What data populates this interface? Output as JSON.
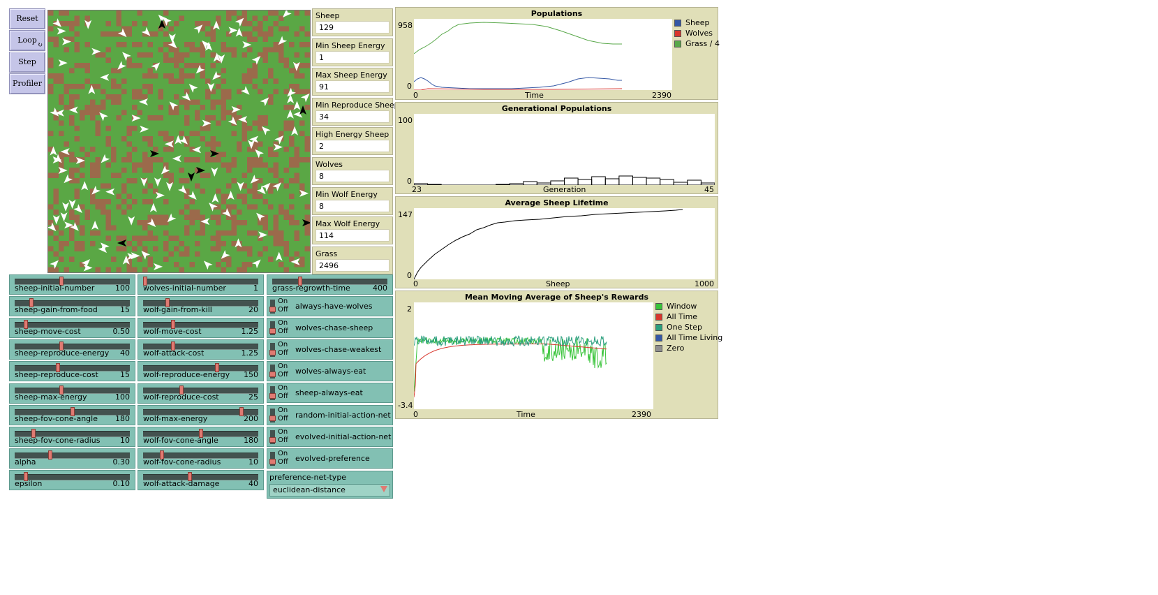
{
  "buttons": {
    "reset": "Reset",
    "loop": "Loop",
    "step": "Step",
    "profiler": "Profiler"
  },
  "monitors": [
    {
      "label": "Sheep",
      "value": "129"
    },
    {
      "label": "Min Sheep Energy",
      "value": "1"
    },
    {
      "label": "Max Sheep Energy",
      "value": "91"
    },
    {
      "label": "Min Reproduce Sheep",
      "value": "34"
    },
    {
      "label": "High Energy Sheep",
      "value": "2"
    },
    {
      "label": "Wolves",
      "value": "8"
    },
    {
      "label": "Min Wolf Energy",
      "value": "8"
    },
    {
      "label": "Max Wolf Energy",
      "value": "114"
    },
    {
      "label": "Grass",
      "value": "2496"
    }
  ],
  "sliders_col1": [
    {
      "name": "sheep-initial-number",
      "value": "100",
      "level": 0.4
    },
    {
      "name": "sheep-gain-from-food",
      "value": "15",
      "level": 0.13
    },
    {
      "name": "sheep-move-cost",
      "value": "0.50",
      "level": 0.08
    },
    {
      "name": "sheep-reproduce-energy",
      "value": "40",
      "level": 0.4
    },
    {
      "name": "sheep-reproduce-cost",
      "value": "15",
      "level": 0.37
    },
    {
      "name": "sheep-max-energy",
      "value": "100",
      "level": 0.4
    },
    {
      "name": "sheep-fov-cone-angle",
      "value": "180",
      "level": 0.5
    },
    {
      "name": "sheep-fov-cone-radius",
      "value": "10",
      "level": 0.15
    },
    {
      "name": "alpha",
      "value": "0.30",
      "level": 0.3
    },
    {
      "name": "epsilon",
      "value": "0.10",
      "level": 0.08
    }
  ],
  "sliders_col2": [
    {
      "name": "wolves-initial-number",
      "value": "1",
      "level": 0.0
    },
    {
      "name": "wolf-gain-from-kill",
      "value": "20",
      "level": 0.2
    },
    {
      "name": "wolf-move-cost",
      "value": "1.25",
      "level": 0.25
    },
    {
      "name": "wolf-attack-cost",
      "value": "1.25",
      "level": 0.25
    },
    {
      "name": "wolf-reproduce-energy",
      "value": "150",
      "level": 0.65
    },
    {
      "name": "wolf-reproduce-cost",
      "value": "25",
      "level": 0.33
    },
    {
      "name": "wolf-max-energy",
      "value": "200",
      "level": 0.87
    },
    {
      "name": "wolf-fov-cone-angle",
      "value": "180",
      "level": 0.5
    },
    {
      "name": "wolf-fov-cone-radius",
      "value": "10",
      "level": 0.15
    },
    {
      "name": "wolf-attack-damage",
      "value": "40",
      "level": 0.4
    }
  ],
  "grass_slider": {
    "name": "grass-regrowth-time",
    "value": "400",
    "level": 0.23
  },
  "switches": [
    {
      "on": "On",
      "off": "Off",
      "name": "always-have-wolves"
    },
    {
      "on": "On",
      "off": "Off",
      "name": "wolves-chase-sheep"
    },
    {
      "on": "On",
      "off": "Off",
      "name": "wolves-chase-weakest"
    },
    {
      "on": "On",
      "off": "Off",
      "name": "wolves-always-eat"
    },
    {
      "on": "On",
      "off": "Off",
      "name": "sheep-always-eat"
    },
    {
      "on": "On",
      "off": "Off",
      "name": "random-initial-action-net"
    },
    {
      "on": "On",
      "off": "Off",
      "name": "evolved-initial-action-net"
    },
    {
      "on": "On",
      "off": "Off",
      "name": "evolved-preference"
    }
  ],
  "chooser": {
    "label": "preference-net-type",
    "value": "euclidean-distance"
  },
  "plots": {
    "populations": {
      "title": "Populations",
      "ymin": "0",
      "ymax": "958",
      "xmin": "0",
      "xmax": "2390",
      "xlabel": "Time",
      "legend": [
        {
          "name": "Sheep",
          "color": "#3457a5"
        },
        {
          "name": "Wolves",
          "color": "#d8362c"
        },
        {
          "name": "Grass / 4",
          "color": "#59a84a"
        }
      ]
    },
    "generational": {
      "title": "Generational Populations",
      "ymin": "0",
      "ymax": "100",
      "xmin": "23",
      "xmax": "45",
      "xlabel": "Generation"
    },
    "lifetime": {
      "title": "Average Sheep Lifetime",
      "ymin": "0",
      "ymax": "147",
      "xmin": "0",
      "xmax": "1000",
      "xlabel": "Sheep"
    },
    "rewards": {
      "title": "Mean Moving Average of Sheep's Rewards",
      "ymin": "-3.4",
      "ymax": "2",
      "xmin": "0",
      "xmax": "2390",
      "xlabel": "Time",
      "legend": [
        {
          "name": "Window",
          "color": "#39c43a"
        },
        {
          "name": "All Time",
          "color": "#d8362c"
        },
        {
          "name": "One Step",
          "color": "#2a9f7d"
        },
        {
          "name": "All Time Living",
          "color": "#3457a5"
        },
        {
          "name": "Zero",
          "color": "#8f8f8f"
        }
      ]
    }
  },
  "colors": {
    "grass": "#5aa745",
    "dirt": "#9b6a4b",
    "sheep": "#ffffff",
    "wolf": "#000000"
  }
}
